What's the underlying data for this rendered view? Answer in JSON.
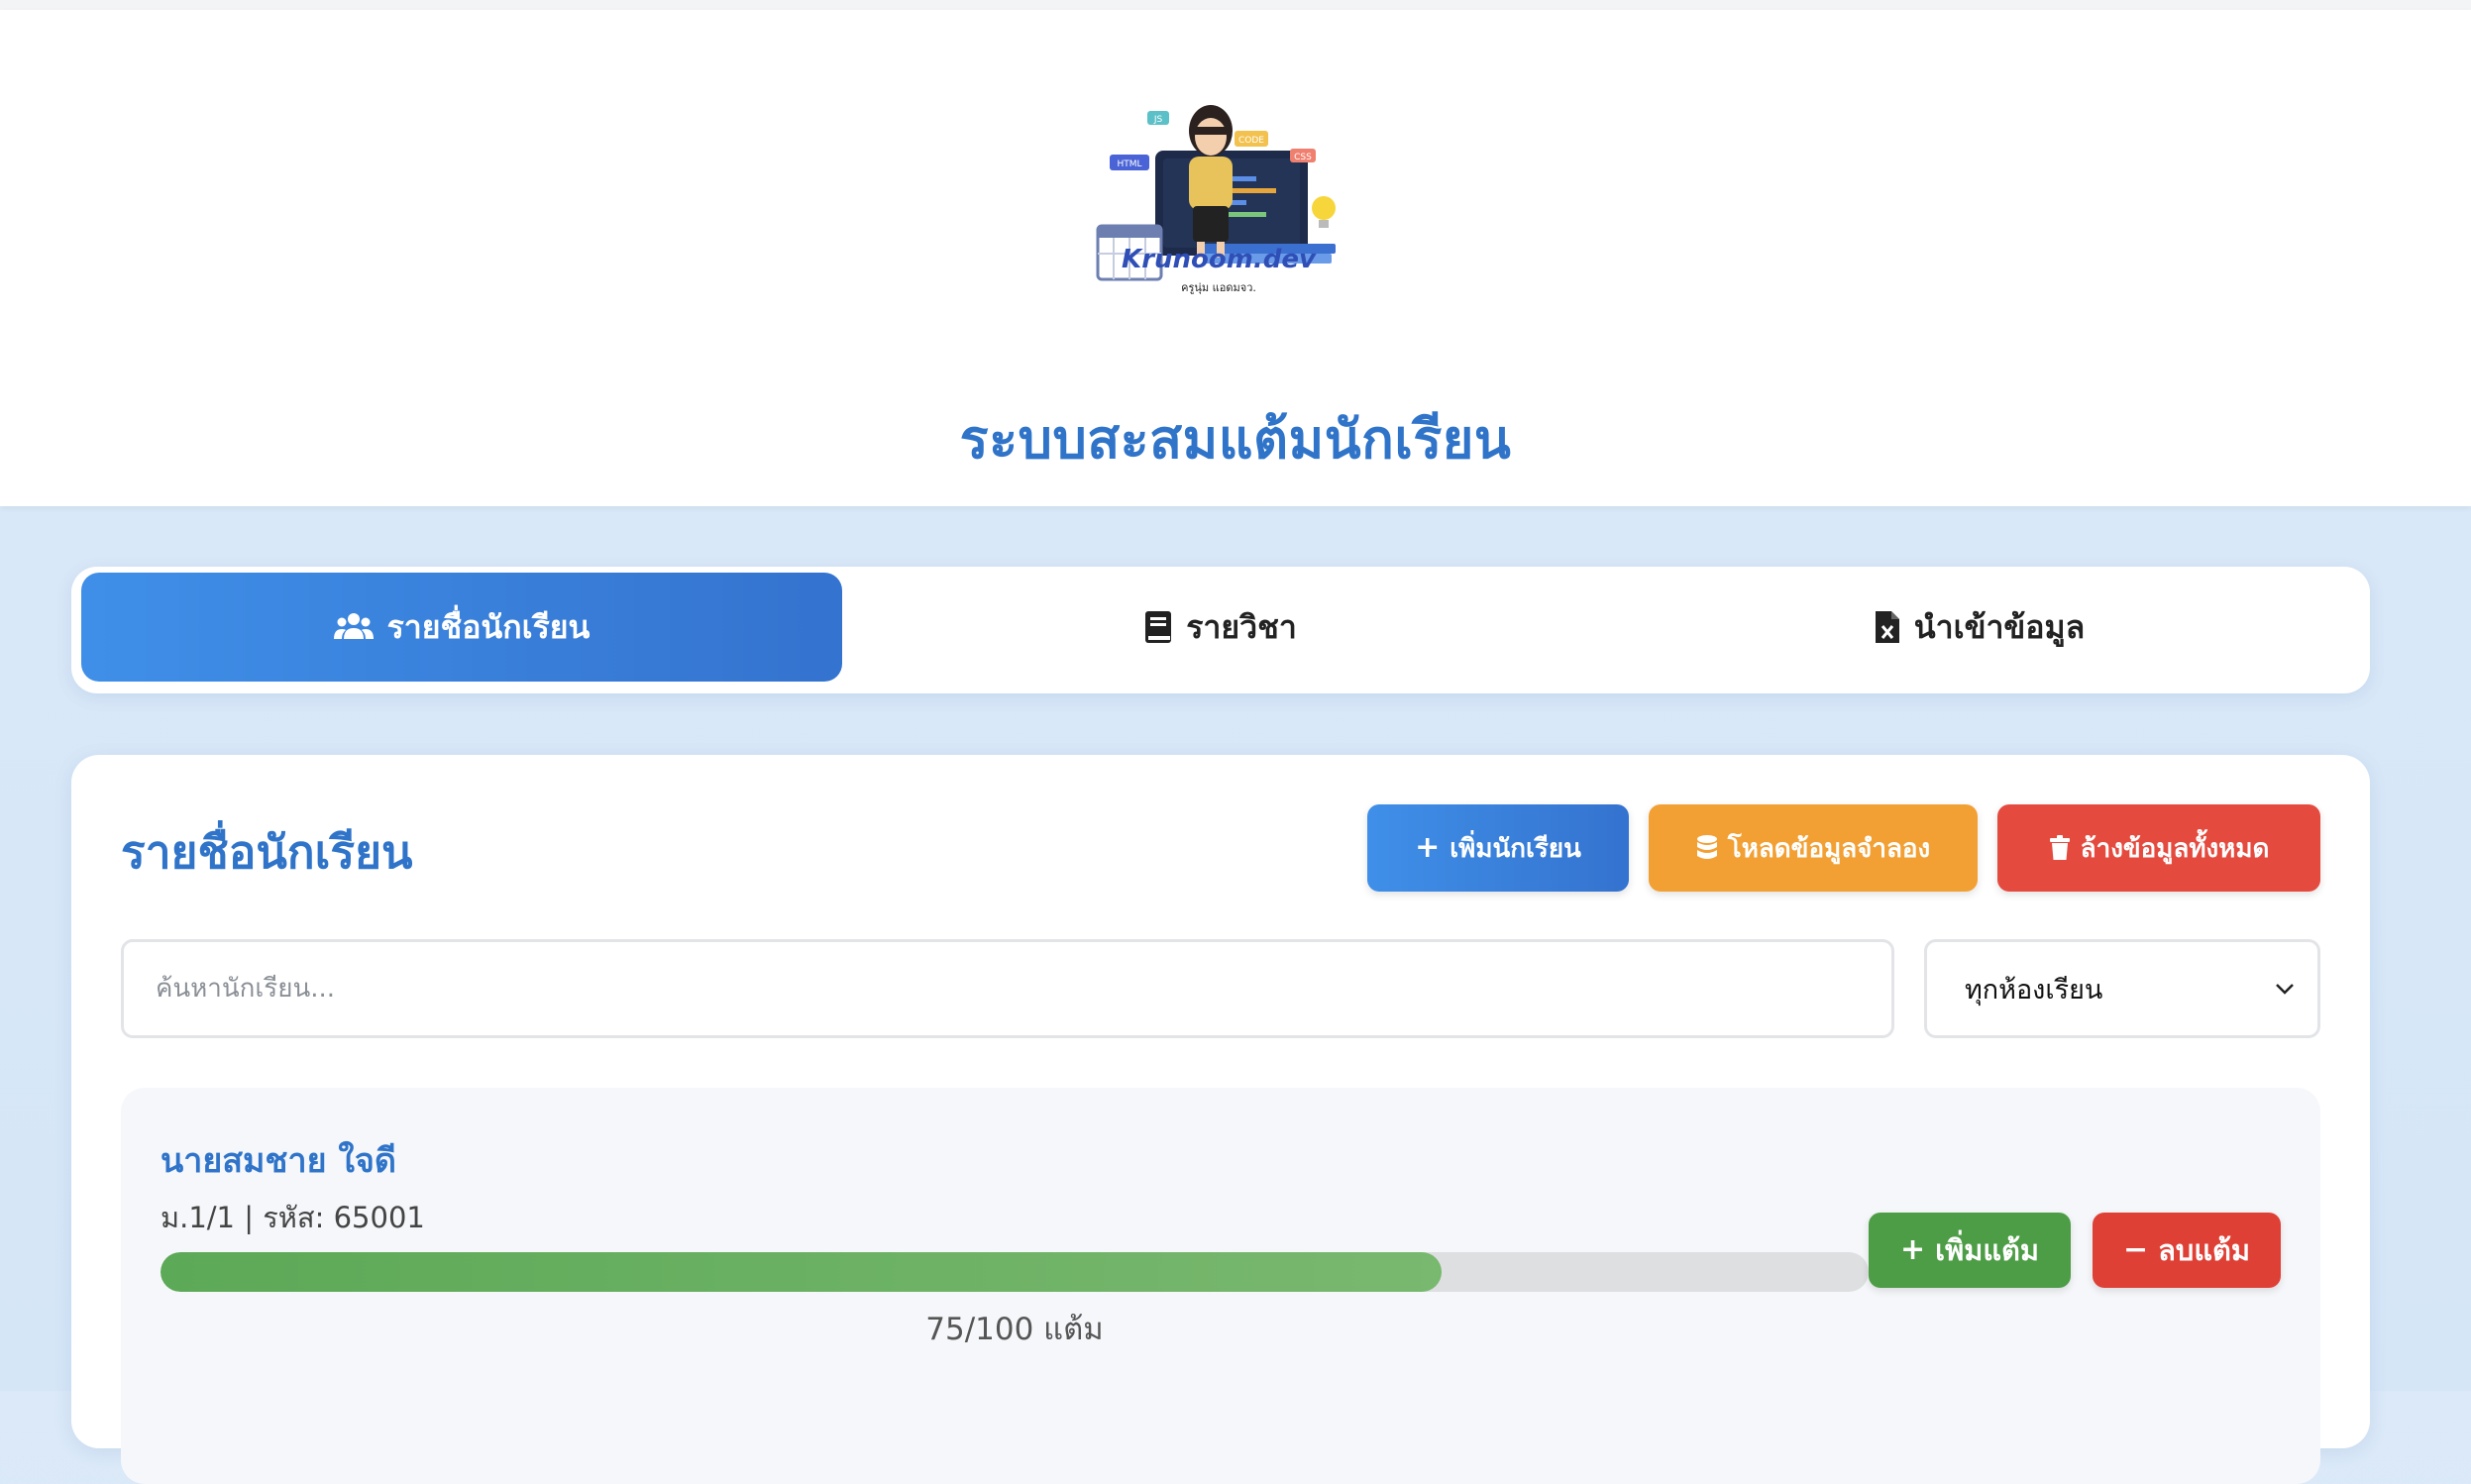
{
  "header": {
    "logo": {
      "brand_text": "Krunoom.dev",
      "tagline": "ครูนุ่ม แอดมจว.",
      "code_tags": [
        "JS",
        "HTML",
        "CODE",
        "CSS"
      ]
    },
    "title": "ระบบสะสมแต้มนักเรียน"
  },
  "tabs": [
    {
      "label": "รายชื่อนักเรียน",
      "icon": "users-icon",
      "active": true
    },
    {
      "label": "รายวิชา",
      "icon": "book-icon",
      "active": false
    },
    {
      "label": "นำเข้าข้อมูล",
      "icon": "excel-file-icon",
      "active": false
    }
  ],
  "students_section": {
    "title": "รายชื่อนักเรียน",
    "add_button": "เพิ่มนักเรียน",
    "load_sample_button": "โหลดข้อมูลจำลอง",
    "clear_all_button": "ล้างข้อมูลทั้งหมด",
    "search_placeholder": "ค้นหานักเรียน...",
    "class_filter": {
      "selected": "ทุกห้องเรียน"
    }
  },
  "students": [
    {
      "name": "นายสมชาย ใจดี",
      "meta": "ม.1/1 | รหัส: 65001",
      "score": 75,
      "max_score": 100,
      "score_label": "75/100 แต้ม",
      "add_points_label": "เพิ่มแต้ม",
      "remove_points_label": "ลบแต้ม"
    }
  ],
  "colors": {
    "primary": "#3473cf",
    "orange": "#f2a034",
    "red": "#e54a3f",
    "green": "#4d9d46",
    "title_blue": "#2f74c9"
  }
}
